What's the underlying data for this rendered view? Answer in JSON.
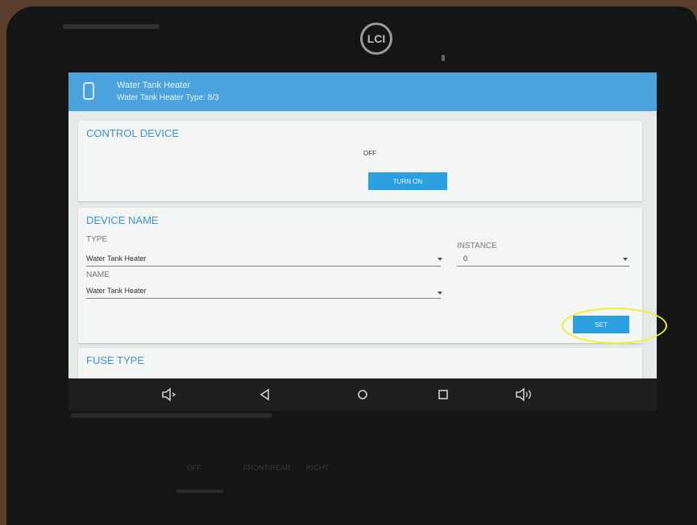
{
  "device": {
    "logo": "LCI",
    "bezel_labels": [
      "OFF",
      "FRONT/REAR",
      "RIGHT"
    ]
  },
  "app": {
    "title": "Water Tank Heater",
    "subtitle": "Water Tank Heater Type: 8/3"
  },
  "control_device": {
    "title": "CONTROL DEVICE",
    "state": "OFF",
    "toggle_label": "TURN ON"
  },
  "device_name": {
    "title": "DEVICE NAME",
    "type_label": "TYPE",
    "type_value": "Water Tank Heater",
    "instance_label": "INSTANCE",
    "instance_value": "0",
    "name_label": "NAME",
    "name_value": "Water Tank Heater",
    "set_label": "SET"
  },
  "fuse_type": {
    "title": "FUSE TYPE"
  },
  "annotation": {
    "highlight_color": "#eef22c"
  },
  "navbar": {
    "icons": [
      "volume-down-icon",
      "back-icon",
      "home-icon",
      "recents-icon",
      "volume-up-icon"
    ]
  }
}
